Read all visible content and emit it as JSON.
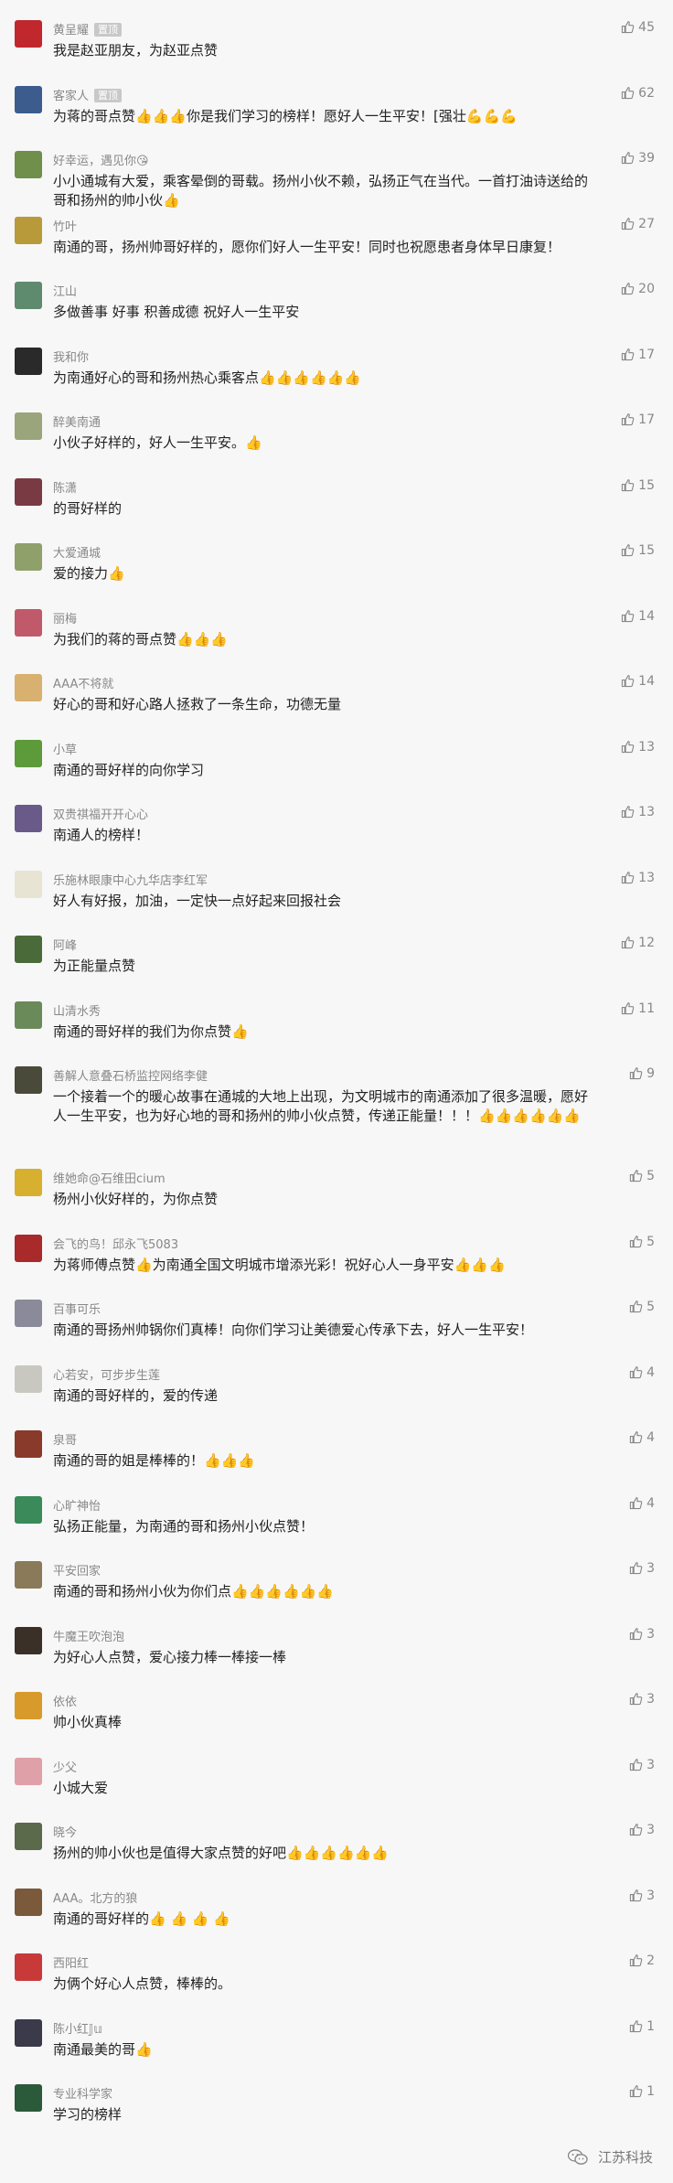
{
  "author_badge": "置顶",
  "watermark": {
    "text": "江苏科技"
  },
  "comments": [
    {
      "nickname": "黄呈耀",
      "badge": true,
      "text": "我是赵亚朋友，为赵亚点赞",
      "thumbs": 0,
      "likes": "45",
      "avatar_color": "#c0282d"
    },
    {
      "nickname": "客家人",
      "badge": true,
      "text": "为蒋的哥点赞👍👍👍你是我们学习的榜样！愿好人一生平安！[强壮💪💪💪",
      "thumbs": 0,
      "likes": "62",
      "avatar_color": "#3b5c8c"
    },
    {
      "nickname": "好幸运，遇见你😘",
      "badge": false,
      "text": "小小通城有大爱，乘客晕倒的哥载。扬州小伙不赖，弘扬正气在当代。一首打油诗送给的哥和扬州的帅小伙👍",
      "thumbs": 0,
      "likes": "39",
      "avatar_color": "#6f8f4a"
    },
    {
      "nickname": "竹叶",
      "badge": false,
      "text": "南通的哥，扬州帅哥好样的，愿你们好人一生平安！同时也祝愿患者身体早日康复！",
      "thumbs": 0,
      "likes": "27",
      "avatar_color": "#b89a3a"
    },
    {
      "nickname": "江山",
      "badge": false,
      "text": "多做善事 好事 积善成德 祝好人一生平安",
      "thumbs": 0,
      "likes": "20",
      "avatar_color": "#5e8a6e"
    },
    {
      "nickname": "我和你",
      "badge": false,
      "text": "为南通好心的哥和扬州热心乘客点👍👍👍👍👍👍",
      "thumbs": 0,
      "likes": "17",
      "avatar_color": "#2a2a2a"
    },
    {
      "nickname": "醉美南通",
      "badge": false,
      "text": "小伙子好样的，好人一生平安。👍",
      "thumbs": 0,
      "likes": "17",
      "avatar_color": "#9aa57c"
    },
    {
      "nickname": "陈潇",
      "badge": false,
      "text": "的哥好样的",
      "thumbs": 0,
      "likes": "15",
      "avatar_color": "#7a3a44"
    },
    {
      "nickname": "大爱通城",
      "badge": false,
      "text": "爱的接力👍",
      "thumbs": 0,
      "likes": "15",
      "avatar_color": "#8fa06a"
    },
    {
      "nickname": "丽梅",
      "badge": false,
      "text": "为我们的蒋的哥点赞👍👍👍",
      "thumbs": 0,
      "likes": "14",
      "avatar_color": "#c05a6a"
    },
    {
      "nickname": "AAA不将就",
      "badge": false,
      "text": "好心的哥和好心路人拯救了一条生命，功德无量",
      "thumbs": 0,
      "likes": "14",
      "avatar_color": "#d8b070"
    },
    {
      "nickname": "小草",
      "badge": false,
      "text": "南通的哥好样的向你学习",
      "thumbs": 0,
      "likes": "13",
      "avatar_color": "#5c9a3a"
    },
    {
      "nickname": "双贵祺福开开心心",
      "badge": false,
      "text": "南通人的榜样！",
      "thumbs": 0,
      "likes": "13",
      "avatar_color": "#6a5a8a"
    },
    {
      "nickname": "乐施林眼康中心九华店李红军",
      "badge": false,
      "text": "好人有好报，加油，一定快一点好起来回报社会",
      "thumbs": 0,
      "likes": "13",
      "avatar_color": "#e8e4d4"
    },
    {
      "nickname": "阿峰",
      "badge": false,
      "text": "为正能量点赞",
      "thumbs": 0,
      "likes": "12",
      "avatar_color": "#4a6a3a"
    },
    {
      "nickname": "山清水秀",
      "badge": false,
      "text": "南通的哥好样的我们为你点赞👍",
      "thumbs": 0,
      "likes": "11",
      "avatar_color": "#6a8a5a"
    },
    {
      "nickname": "善解人意叠石桥监控网络李健",
      "badge": false,
      "text": "一个接着一个的暖心故事在通城的大地上出现，为文明城市的南通添加了很多温暖，愿好人一生平安，也为好心地的哥和扬州的帅小伙点赞，传递正能量！！！👍👍👍👍👍👍",
      "thumbs": 0,
      "likes": "9",
      "avatar_color": "#4a4a3a",
      "tall": true
    },
    {
      "nickname": "维她命@石维田cium",
      "badge": false,
      "text": "杨州小伙好样的，为你点赞",
      "thumbs": 0,
      "likes": "5",
      "avatar_color": "#d8b030"
    },
    {
      "nickname": "会飞的鸟！邱永飞5083",
      "badge": false,
      "text": "为蒋师傅点赞👍为南通全国文明城市增添光彩！祝好心人一身平安👍👍👍",
      "thumbs": 0,
      "likes": "5",
      "avatar_color": "#a82a2a"
    },
    {
      "nickname": "百事可乐",
      "badge": false,
      "text": "南通的哥扬州帅锅你们真棒！向你们学习让美德爱心传承下去，好人一生平安！",
      "thumbs": 0,
      "likes": "5",
      "avatar_color": "#8a8a9a"
    },
    {
      "nickname": "心若安，可步步生莲",
      "badge": false,
      "text": "南通的哥好样的，爱的传递",
      "thumbs": 0,
      "likes": "4",
      "avatar_color": "#c8c8c0"
    },
    {
      "nickname": "泉哥",
      "badge": false,
      "text": "南通的哥的姐是棒棒的！👍👍👍",
      "thumbs": 0,
      "likes": "4",
      "avatar_color": "#8a3a2a"
    },
    {
      "nickname": "心旷神怡",
      "badge": false,
      "text": "弘扬正能量，为南通的哥和扬州小伙点赞！",
      "thumbs": 0,
      "likes": "4",
      "avatar_color": "#3a8a5a"
    },
    {
      "nickname": "平安回家",
      "badge": false,
      "text": "南通的哥和扬州小伙为你们点👍👍👍👍👍👍",
      "thumbs": 0,
      "likes": "3",
      "avatar_color": "#8a7a5a"
    },
    {
      "nickname": "牛魔王吹泡泡",
      "badge": false,
      "text": "为好心人点赞，爱心接力棒一棒接一棒",
      "thumbs": 0,
      "likes": "3",
      "avatar_color": "#3a3028"
    },
    {
      "nickname": "依依",
      "badge": false,
      "text": "帅小伙真棒",
      "thumbs": 0,
      "likes": "3",
      "avatar_color": "#d89a2a"
    },
    {
      "nickname": "少父",
      "badge": false,
      "text": "小城大爱",
      "thumbs": 0,
      "likes": "3",
      "avatar_color": "#e0a0a8"
    },
    {
      "nickname": "晓今",
      "badge": false,
      "text": "扬州的帅小伙也是值得大家点赞的好吧👍👍👍👍👍👍",
      "thumbs": 0,
      "likes": "3",
      "avatar_color": "#5a6a4a"
    },
    {
      "nickname": "AAA。北方的狼",
      "badge": false,
      "text": "南通的哥好样的👍 👍 👍 👍",
      "thumbs": 0,
      "likes": "3",
      "avatar_color": "#7a5a3a"
    },
    {
      "nickname": "西阳红",
      "badge": false,
      "text": "为俩个好心人点赞，棒棒的。",
      "thumbs": 0,
      "likes": "2",
      "avatar_color": "#c83a3a"
    },
    {
      "nickname": "陈小红𝕁𝕦",
      "badge": false,
      "text": "南通最美的哥👍",
      "thumbs": 0,
      "likes": "1",
      "avatar_color": "#3a3a4a"
    },
    {
      "nickname": "专业科学家",
      "badge": false,
      "text": "学习的榜样",
      "thumbs": 0,
      "likes": "1",
      "avatar_color": "#2a5a3a"
    }
  ]
}
